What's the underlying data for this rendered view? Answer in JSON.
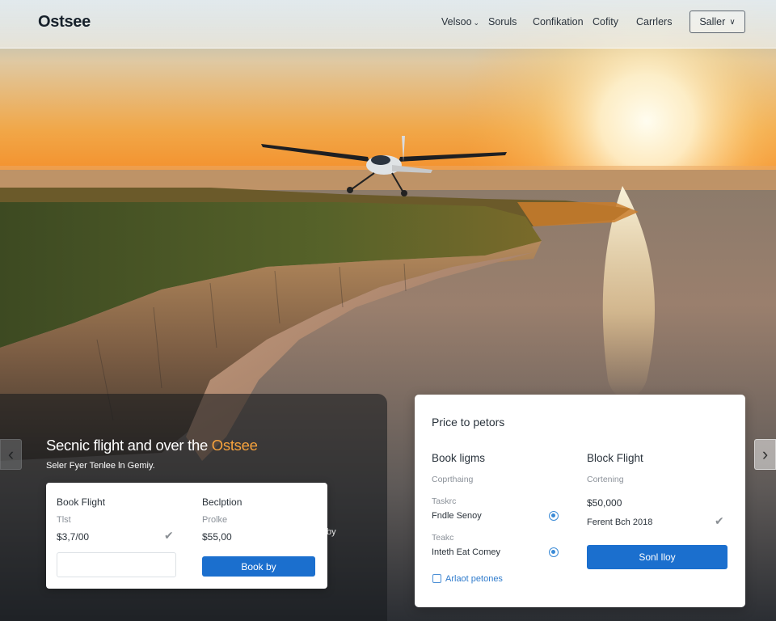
{
  "header": {
    "logo": "Ostsee",
    "nav": [
      {
        "label": "Velsoo",
        "has_dropdown": true
      },
      {
        "label": "Soruls",
        "has_dropdown": false
      },
      {
        "label": "Confikation",
        "has_dropdown": false
      },
      {
        "label": "Cofity",
        "has_dropdown": false
      },
      {
        "label": "Carrlers",
        "has_dropdown": false
      }
    ],
    "select_label": "Saller"
  },
  "hero": {
    "title_main": "Secnic flight and over the ",
    "title_accent": "Ostsee",
    "subtitle": "Seler Fyer Tenlee ln Gemiy.",
    "side_text": "by"
  },
  "booking_card": {
    "col1_title": "Book Flight",
    "col1_label": "Tlst",
    "col1_value": "$3,7/00",
    "col2_title": "Beclption",
    "col2_label": "Prolke",
    "col2_value": "$55,00",
    "button": "Book by"
  },
  "price_card": {
    "title": "Price to petors",
    "left": {
      "heading": "Book ligms",
      "label": "Coprthaing",
      "option1_label": "Taskrc",
      "option1": "Fndle Senoy",
      "option2_label": "Teakc",
      "option2": "Inteth Eat Comey",
      "checkbox": "Arlaot petones"
    },
    "right": {
      "heading": "Block Flight",
      "label": "Cortening",
      "price": "$50,000",
      "detail": "Ferent Bch 2018",
      "button": "Sonl lloy"
    }
  },
  "colors": {
    "accent": "#f6a23c",
    "primary": "#1b6fce"
  },
  "icons": {
    "left_arrow": "chevron-left-icon",
    "right_arrow": "chevron-right-icon",
    "check": "check-icon",
    "dropdown": "chevron-down-icon"
  }
}
